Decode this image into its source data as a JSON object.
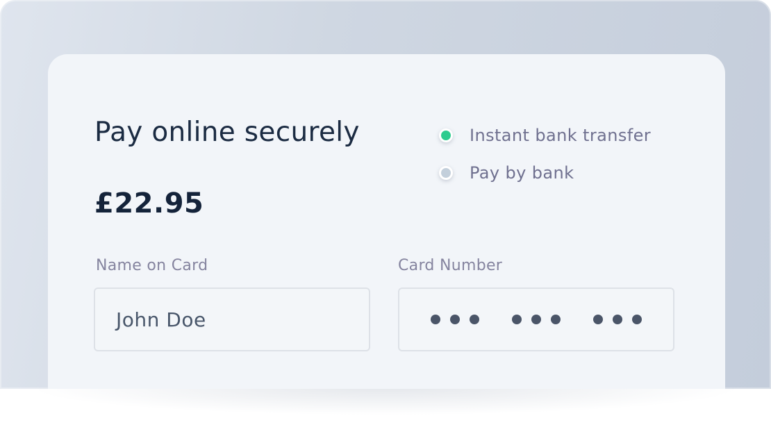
{
  "payment": {
    "title": "Pay online securely",
    "amount": "£22.95",
    "methods": [
      {
        "label": "Instant bank transfer",
        "selected": true,
        "color": "#2ecc8f"
      },
      {
        "label": "Pay by bank",
        "selected": false,
        "color": "#c3cfdb"
      }
    ],
    "name_field": {
      "label": "Name on Card",
      "value": "John Doe"
    },
    "card_field": {
      "label": "Card Number",
      "masked_groups": 3,
      "dots_per_group": 3
    }
  }
}
